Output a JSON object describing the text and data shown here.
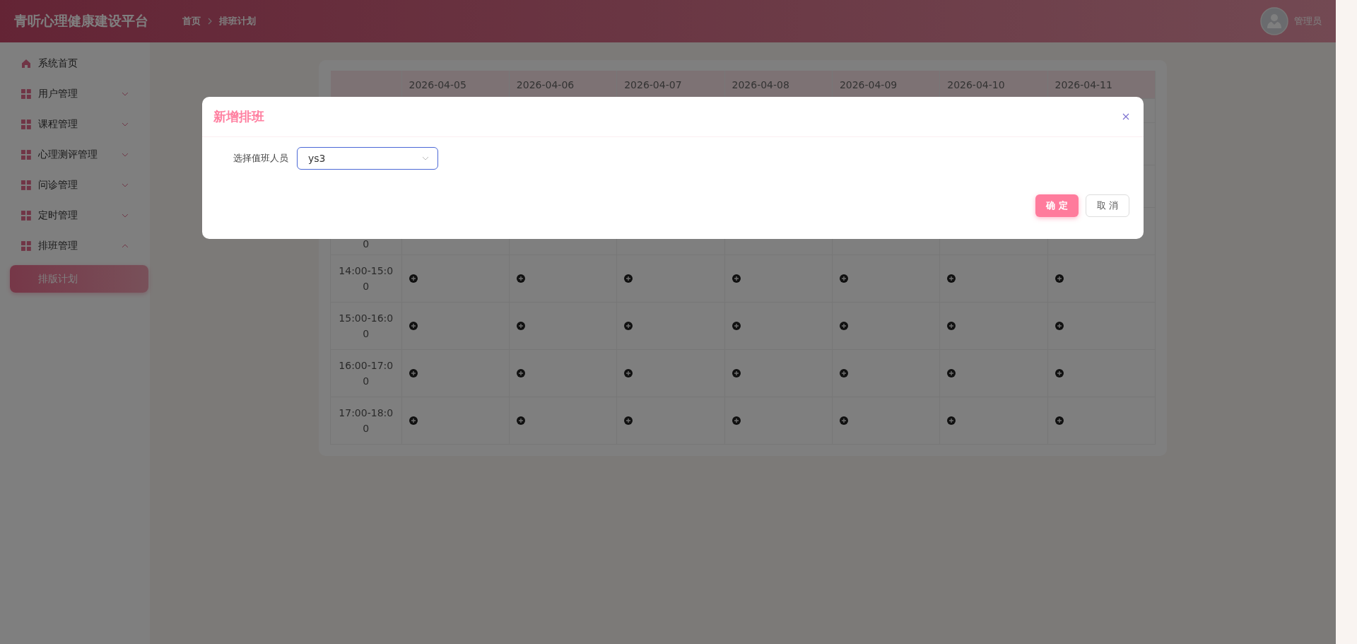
{
  "header": {
    "title": "青听心理健康建设平台",
    "breadcrumb": [
      "首页",
      "排班计划"
    ],
    "user": "管理员"
  },
  "sidebar": {
    "items": [
      {
        "label": "系统首页",
        "kind": "home"
      },
      {
        "label": "用户管理",
        "kind": "group",
        "expanded": false
      },
      {
        "label": "课程管理",
        "kind": "group",
        "expanded": false
      },
      {
        "label": "心理测评管理",
        "kind": "group",
        "expanded": false
      },
      {
        "label": "问诊管理",
        "kind": "group",
        "expanded": false
      },
      {
        "label": "定时管理",
        "kind": "group",
        "expanded": false
      },
      {
        "label": "排班管理",
        "kind": "group",
        "expanded": true,
        "children": [
          {
            "label": "排版计划",
            "selected": true
          }
        ]
      }
    ]
  },
  "schedule": {
    "columns": [
      "2026-04-05",
      "2026-04-06",
      "2026-04-07",
      "2026-04-08",
      "2026-04-09",
      "2026-04-10",
      "2026-04-11"
    ],
    "rows": [
      {
        "time": "0",
        "partial": true
      },
      {
        "time": "14:00-15:00",
        "partial": false
      },
      {
        "time": "15:00-16:00",
        "partial": false
      },
      {
        "time": "16:00-17:00",
        "partial": false
      },
      {
        "time": "17:00-18:00",
        "partial": false
      }
    ]
  },
  "dialog": {
    "title": "新增排班",
    "field_label": "选择值班人员",
    "field_value": "ys3",
    "buttons": [
      {
        "label": "确 定",
        "kind": "primary"
      },
      {
        "label": "取 消",
        "kind": "default"
      }
    ]
  }
}
